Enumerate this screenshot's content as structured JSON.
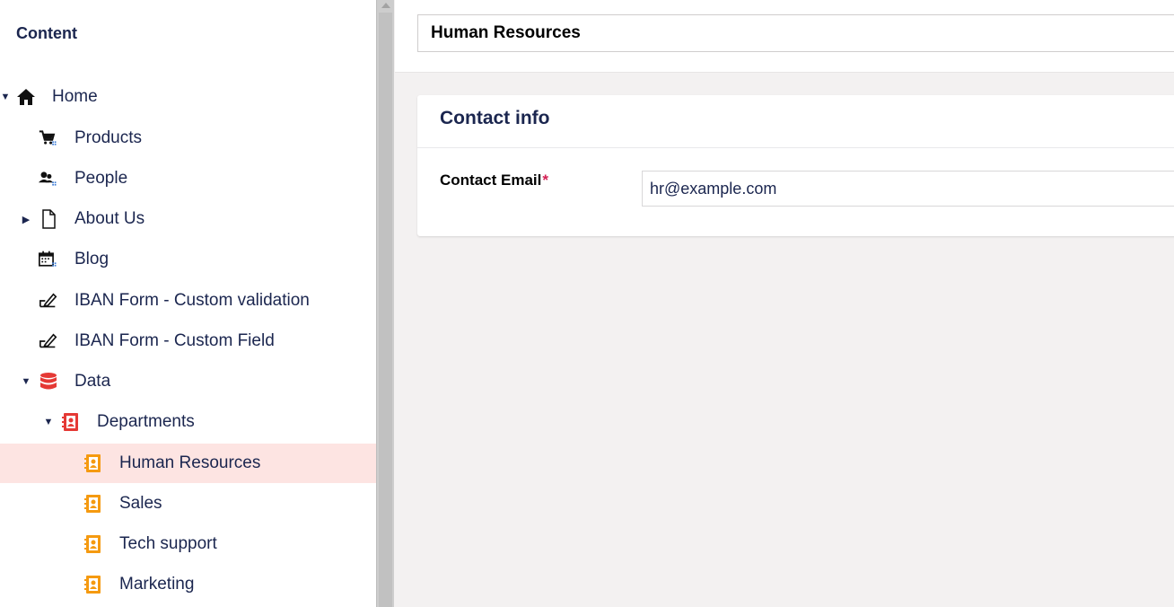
{
  "sidebar": {
    "title": "Content",
    "items": [
      {
        "label": "Home",
        "icon": "home-icon",
        "caret": "expanded"
      },
      {
        "label": "Products",
        "icon": "shopping-cart-icon",
        "caret": "none"
      },
      {
        "label": "People",
        "icon": "users-icon",
        "caret": "none"
      },
      {
        "label": "About Us",
        "icon": "document-icon",
        "caret": "collapsed"
      },
      {
        "label": "Blog",
        "icon": "calendar-icon",
        "caret": "none"
      },
      {
        "label": "IBAN Form - Custom validation",
        "icon": "edit-form-icon",
        "caret": "none"
      },
      {
        "label": "IBAN Form - Custom Field",
        "icon": "edit-form-icon",
        "caret": "none"
      },
      {
        "label": "Data",
        "icon": "database-icon",
        "caret": "expanded"
      },
      {
        "label": "Departments",
        "icon": "contact-book-icon",
        "caret": "expanded"
      },
      {
        "label": "Human Resources",
        "icon": "contact-book-icon",
        "caret": "none",
        "selected": true
      },
      {
        "label": "Sales",
        "icon": "contact-book-icon",
        "caret": "none"
      },
      {
        "label": "Tech support",
        "icon": "contact-book-icon",
        "caret": "none"
      },
      {
        "label": "Marketing",
        "icon": "contact-book-icon",
        "caret": "none"
      }
    ]
  },
  "editor": {
    "name_value": "Human Resources",
    "group_title": "Contact info",
    "email_label": "Contact Email",
    "email_required_marker": "*",
    "email_value": "hr@example.com"
  },
  "colors": {
    "selected_row": "#fde4e2",
    "text": "#1b264f",
    "database_icon": "#e53935",
    "contact_book_red": "#e53935",
    "contact_book_orange": "#f59a10",
    "required": "#d42054"
  }
}
